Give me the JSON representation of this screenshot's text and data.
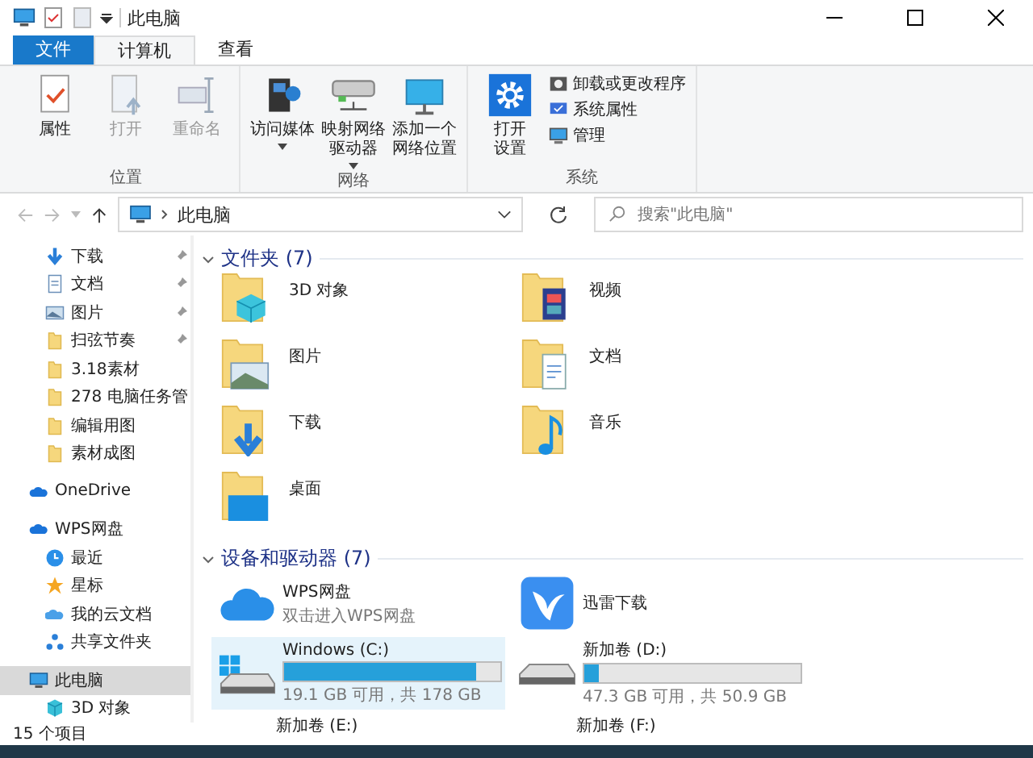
{
  "window": {
    "title": "此电脑"
  },
  "ribbon_tabs": [
    {
      "label": "文件",
      "kind": "file",
      "selected": false
    },
    {
      "label": "计算机",
      "kind": "tab",
      "selected": true
    },
    {
      "label": "查看",
      "kind": "tab",
      "selected": false
    }
  ],
  "ribbon_groups": [
    {
      "name": "位置",
      "commands": [
        {
          "lines": [
            "属性"
          ],
          "kind": "properties",
          "disabled": false,
          "dropdown": false
        },
        {
          "lines": [
            "打开"
          ],
          "kind": "open",
          "disabled": true,
          "dropdown": false
        },
        {
          "lines": [
            "重命名"
          ],
          "kind": "rename",
          "disabled": true,
          "dropdown": false
        }
      ]
    },
    {
      "name": "网络",
      "commands": [
        {
          "lines": [
            "访问媒体"
          ],
          "kind": "media",
          "disabled": false,
          "dropdown": true
        },
        {
          "lines": [
            "映射网络",
            "驱动器"
          ],
          "kind": "netdrive",
          "disabled": false,
          "dropdown": true
        },
        {
          "lines": [
            "添加一个",
            "网络位置"
          ],
          "kind": "netplace",
          "disabled": false,
          "dropdown": false
        }
      ]
    },
    {
      "name": "系统",
      "commands": [
        {
          "lines": [
            "打开",
            "设置"
          ],
          "kind": "settings",
          "disabled": false,
          "dropdown": false
        }
      ],
      "small_commands": [
        {
          "label": "卸载或更改程序",
          "kind": "uninstall"
        },
        {
          "label": "系统属性",
          "kind": "sysprops"
        },
        {
          "label": "管理",
          "kind": "manage"
        }
      ]
    }
  ],
  "address": {
    "path": "此电脑"
  },
  "search": {
    "placeholder": "搜索\"此电脑\""
  },
  "nav_pane": {
    "quick_access": [
      {
        "label": "下载",
        "kind": "download",
        "pinned": true
      },
      {
        "label": "文档",
        "kind": "document",
        "pinned": true
      },
      {
        "label": "图片",
        "kind": "picture",
        "pinned": true
      },
      {
        "label": "扫弦节奏",
        "kind": "folder",
        "pinned": true
      },
      {
        "label": "3.18素材",
        "kind": "folder",
        "pinned": false
      },
      {
        "label": "278 电脑任务管",
        "kind": "folder",
        "pinned": false
      },
      {
        "label": "编辑用图",
        "kind": "folder",
        "pinned": false
      },
      {
        "label": "素材成图",
        "kind": "folder",
        "pinned": false
      }
    ],
    "items": [
      {
        "label": "OneDrive",
        "kind": "onedrive",
        "selected": false
      },
      {
        "label": "WPS网盘",
        "kind": "cloud",
        "selected": false,
        "children": [
          {
            "label": "最近",
            "kind": "clock",
            "selected": false
          },
          {
            "label": "星标",
            "kind": "star",
            "selected": false
          },
          {
            "label": "我的云文档",
            "kind": "clouddoc",
            "selected": false
          },
          {
            "label": "共享文件夹",
            "kind": "share",
            "selected": false
          }
        ]
      },
      {
        "label": "此电脑",
        "kind": "pc",
        "selected": true,
        "children": [
          {
            "label": "3D 对象",
            "kind": "cube",
            "selected": false
          }
        ]
      }
    ]
  },
  "sections": [
    {
      "title": "文件夹 (7)",
      "expanded": true,
      "kind": "folders",
      "items": [
        {
          "name": "3D 对象",
          "kind": "cube"
        },
        {
          "name": "视频",
          "kind": "film"
        },
        {
          "name": "图片",
          "kind": "picture"
        },
        {
          "name": "文档",
          "kind": "document"
        },
        {
          "name": "下载",
          "kind": "download"
        },
        {
          "name": "音乐",
          "kind": "music"
        },
        {
          "name": "桌面",
          "kind": "desktop"
        }
      ]
    },
    {
      "title": "设备和驱动器 (7)",
      "expanded": true,
      "kind": "devices",
      "items": [
        {
          "kind": "cloud_app",
          "name": "WPS网盘",
          "subtitle": "双击进入WPS网盘"
        },
        {
          "kind": "bird_app",
          "name": "迅雷下载"
        },
        {
          "kind": "system_drive",
          "name": "Windows (C:)",
          "level": 0.89,
          "space": "19.1 GB 可用，共 178 GB",
          "selected": true
        },
        {
          "kind": "drive",
          "name": "新加卷 (D:)",
          "level": 0.07,
          "space": "47.3 GB 可用，共 50.9 GB",
          "selected": false
        },
        {
          "kind": "drive_cut",
          "name": "新加卷 (E:)"
        },
        {
          "kind": "drive_cut",
          "name": "新加卷 (F:)"
        }
      ]
    }
  ],
  "status_bar": {
    "count": "15 个项目"
  }
}
